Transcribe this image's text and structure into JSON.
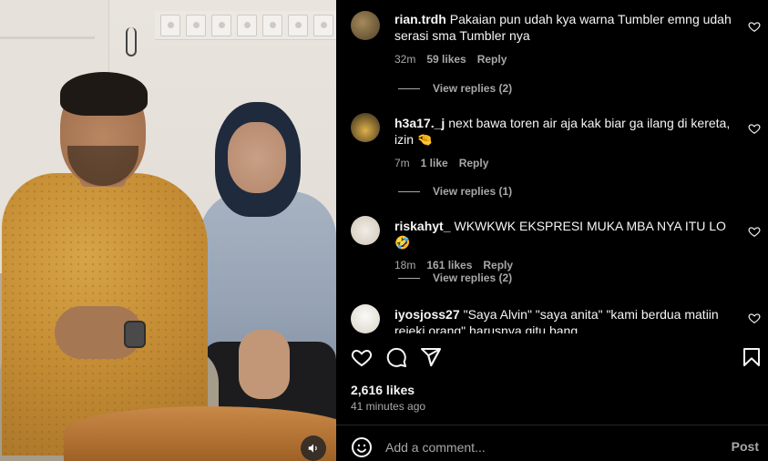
{
  "video": {
    "mute_icon": "speaker-icon"
  },
  "comments": [
    {
      "username": "rian.trdh",
      "text": "Pakaian pun udah kya warna Tumbler emng udah serasi sma Tumbler nya",
      "time": "32m",
      "likes": "59 likes",
      "reply": "Reply",
      "view_replies": "View replies (2)",
      "avatar_color": "#6b5a3e"
    },
    {
      "username": "h3a17._j",
      "text": "next bawa toren air aja kak biar ga ilang di kereta, izin 🤏",
      "time": "7m",
      "likes": "1 like",
      "reply": "Reply",
      "view_replies": "View replies (1)",
      "avatar_color": "#c89a3a"
    },
    {
      "username": "riskahyt_",
      "text": "WKWKWK EKSPRESI MUKA MBA NYA ITU LO 🤣",
      "time": "18m",
      "likes": "161 likes",
      "reply": "Reply",
      "view_replies": "View replies (2)",
      "avatar_color": "#e8e4dc"
    },
    {
      "username": "iyosjoss27",
      "text": "\"Saya Alvin\" \"saya anita\" \"kami berdua matiin rejeki orang\" harusnya gitu bang",
      "avatar_color": "#e6e6e0"
    }
  ],
  "actions": {
    "like_icon": "heart-icon",
    "comment_icon": "comment-icon",
    "share_icon": "share-icon",
    "save_icon": "bookmark-icon"
  },
  "post": {
    "likes": "2,616 likes",
    "time_ago": "41 minutes ago"
  },
  "add_comment": {
    "placeholder": "Add a comment...",
    "post_label": "Post",
    "emoji_icon": "smiley-icon"
  },
  "colors": {
    "background": "#000000",
    "text": "#f5f5f5",
    "secondary_text": "#a8a8a8",
    "divider": "#262626"
  }
}
